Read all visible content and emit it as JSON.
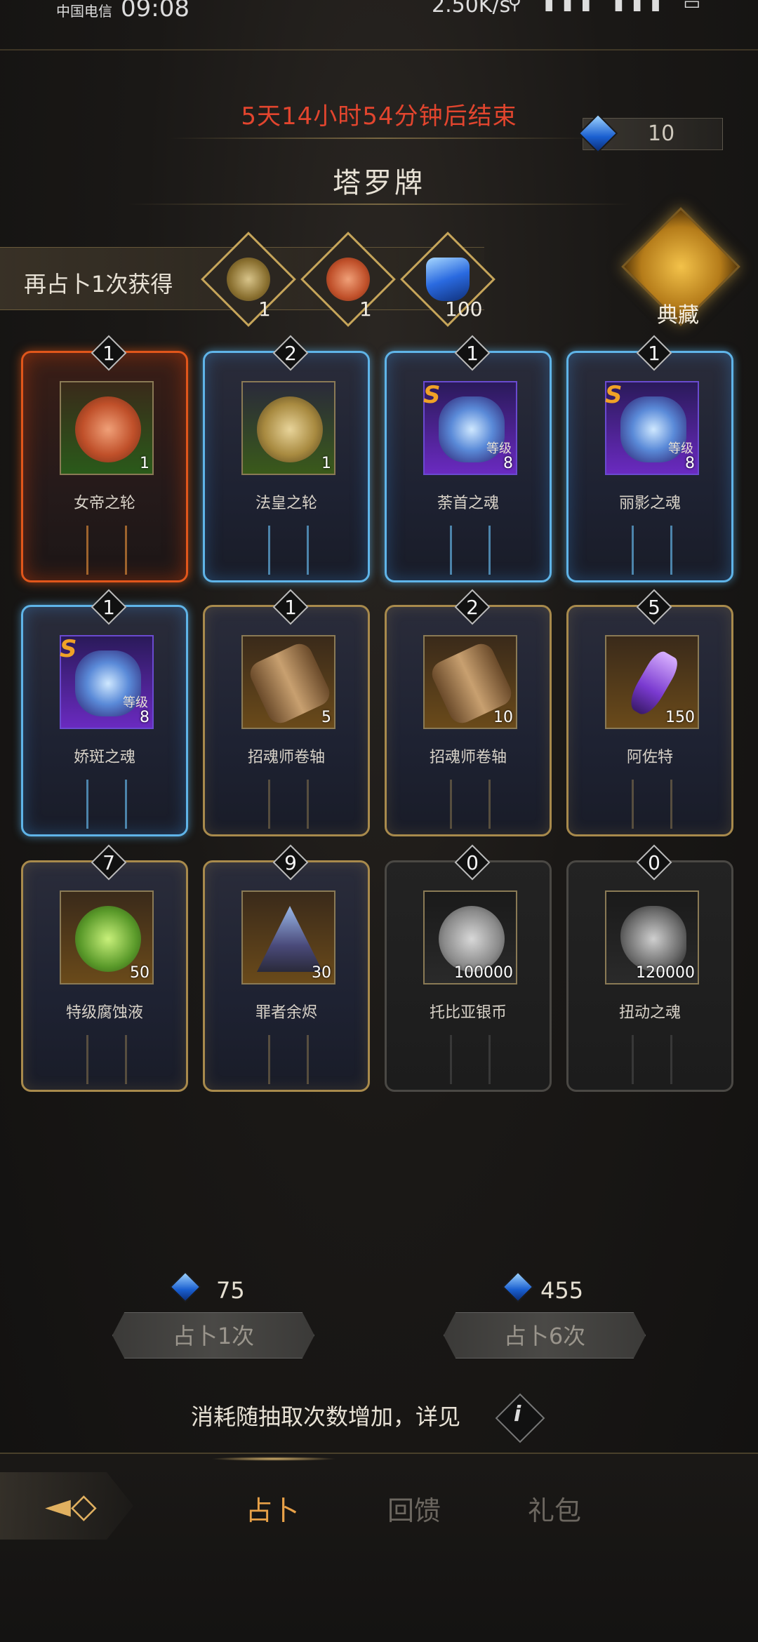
{
  "status_bar": {
    "carrier": "中国电信",
    "time": "09:08",
    "net_speed": "2.50K/s",
    "right_icons": "⚲ ▮▮▮ ▮▮▮ ▭"
  },
  "header": {
    "countdown": "5天14小时54分钟后结束",
    "title": "塔罗牌",
    "currency_value": "10"
  },
  "reward_preview": {
    "label": "再占卜1次获得",
    "items": [
      {
        "icon": "gold-wheel-icon",
        "count": "1"
      },
      {
        "icon": "red-wheel-icon",
        "count": "1"
      },
      {
        "icon": "blue-crystal-icon",
        "count": "100"
      }
    ]
  },
  "collection": {
    "label": "典藏"
  },
  "cards": [
    {
      "badge": "1",
      "name": "女帝之轮",
      "qty": "1",
      "style": "fire",
      "icon": "red-wheel-icon",
      "legendary": false,
      "level_label": ""
    },
    {
      "badge": "2",
      "name": "法皇之轮",
      "qty": "1",
      "style": "ice",
      "icon": "gold-wheel-icon",
      "legendary": false,
      "level_label": ""
    },
    {
      "badge": "1",
      "name": "荼首之魂",
      "qty": "8",
      "style": "ice",
      "icon": "spirit-icon",
      "legendary": true,
      "level_label": "等级"
    },
    {
      "badge": "1",
      "name": "丽影之魂",
      "qty": "8",
      "style": "ice",
      "icon": "spirit-icon",
      "legendary": true,
      "level_label": "等级"
    },
    {
      "badge": "1",
      "name": "娇斑之魂",
      "qty": "8",
      "style": "ice",
      "icon": "spirit-icon",
      "legendary": true,
      "level_label": "等级"
    },
    {
      "badge": "1",
      "name": "招魂师卷轴",
      "qty": "5",
      "style": "gold",
      "icon": "scroll-icon",
      "legendary": false,
      "level_label": ""
    },
    {
      "badge": "2",
      "name": "招魂师卷轴",
      "qty": "10",
      "style": "gold",
      "icon": "scroll-icon",
      "legendary": false,
      "level_label": ""
    },
    {
      "badge": "5",
      "name": "阿佐特",
      "qty": "150",
      "style": "gold",
      "icon": "vial-icon",
      "legendary": false,
      "level_label": ""
    },
    {
      "badge": "7",
      "name": "特级腐蚀液",
      "qty": "50",
      "style": "gold",
      "icon": "potion-icon",
      "legendary": false,
      "level_label": ""
    },
    {
      "badge": "9",
      "name": "罪者余烬",
      "qty": "30",
      "style": "gold",
      "icon": "ember-icon",
      "legendary": false,
      "level_label": ""
    },
    {
      "badge": "0",
      "name": "托比亚银币",
      "qty": "100000",
      "style": "gray",
      "icon": "silver-coin-icon",
      "legendary": false,
      "level_label": ""
    },
    {
      "badge": "0",
      "name": "扭动之魂",
      "qty": "120000",
      "style": "gray",
      "icon": "smoke-icon",
      "legendary": false,
      "level_label": ""
    }
  ],
  "actions": {
    "single": {
      "cost": "75",
      "label": "占卜1次"
    },
    "six": {
      "cost": "455",
      "label": "占卜6次"
    }
  },
  "info_text": "消耗随抽取次数增加，详见",
  "bottom_nav": {
    "tabs": [
      "占卜",
      "回馈",
      "礼包"
    ],
    "active_index": 0
  },
  "colors": {
    "accent": "#e8a148",
    "countdown": "#e2452e",
    "gem_blue": "#1a5fd0",
    "gold": "#c6a55a"
  }
}
